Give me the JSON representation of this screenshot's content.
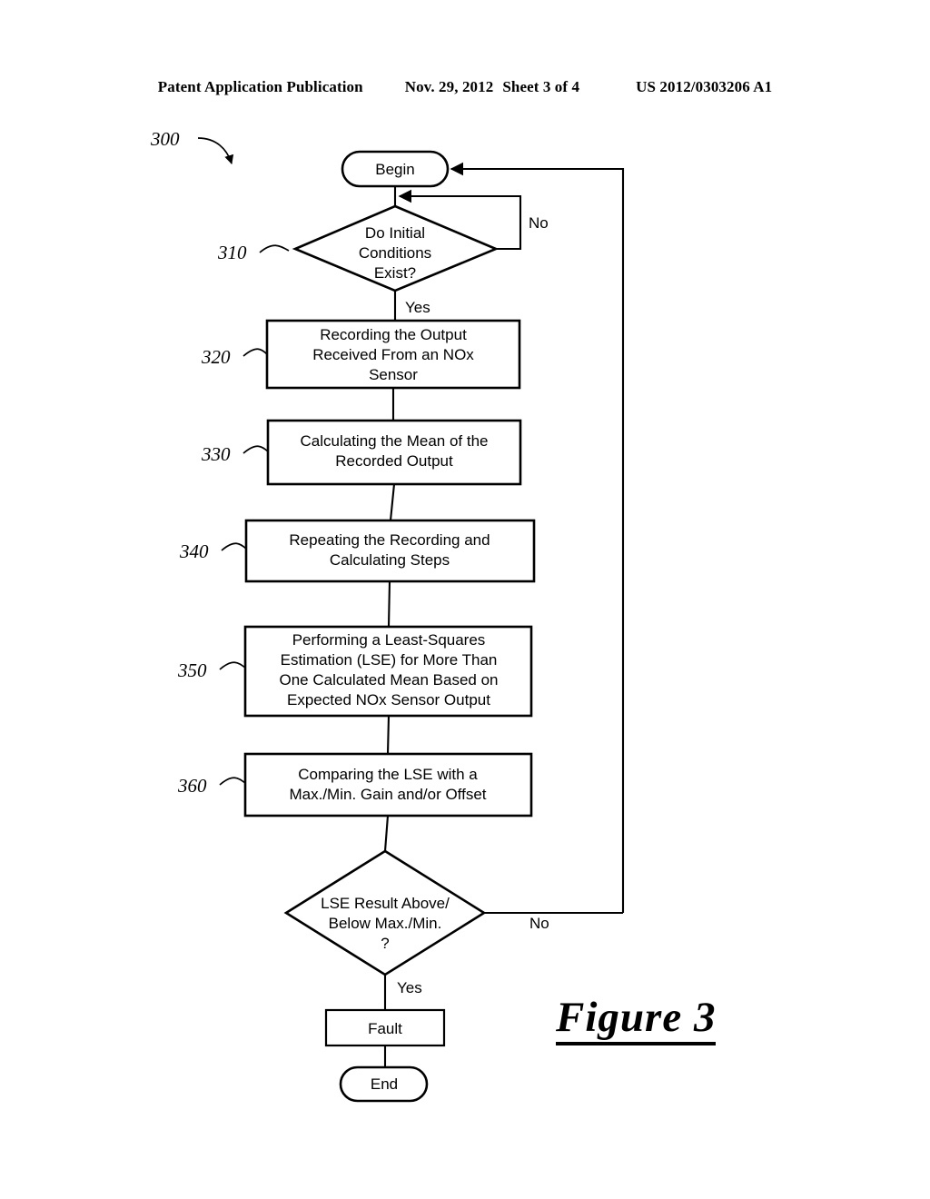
{
  "header": {
    "publication": "Patent Application Publication",
    "date": "Nov. 29, 2012",
    "sheet": "Sheet 3 of 4",
    "patent_number": "US 2012/0303206 A1"
  },
  "figure": {
    "label": "Figure 3",
    "diagram_number": "300"
  },
  "flowchart": {
    "begin": "Begin",
    "end": "End",
    "fault": "Fault",
    "decision_initial": "Do Initial\nConditions\nExist?",
    "decision_initial_lines": [
      "Do Initial",
      "Conditions",
      "Exist?"
    ],
    "decision_result_lines": [
      "LSE Result Above/",
      "Below Max./Min.",
      "?"
    ],
    "steps": [
      {
        "ref": "320",
        "lines": [
          "Recording the Output",
          "Received From an NOx",
          "Sensor"
        ]
      },
      {
        "ref": "330",
        "lines": [
          "Calculating the Mean of the",
          "Recorded Output"
        ]
      },
      {
        "ref": "340",
        "lines": [
          "Repeating the Recording and",
          "Calculating Steps"
        ]
      },
      {
        "ref": "350",
        "lines": [
          "Performing a Least-Squares",
          "Estimation (LSE) for More Than",
          "One Calculated Mean Based on",
          "Expected NOx Sensor Output"
        ]
      },
      {
        "ref": "360",
        "lines": [
          "Comparing the LSE with a",
          "Max./Min. Gain and/or Offset"
        ]
      }
    ],
    "decision_refs": {
      "initial": "310"
    },
    "branch_labels": {
      "no_top": "No",
      "yes_top": "Yes",
      "no_bottom": "No",
      "yes_bottom": "Yes"
    }
  },
  "colors": {
    "ink": "#000000",
    "paper": "#ffffff"
  }
}
